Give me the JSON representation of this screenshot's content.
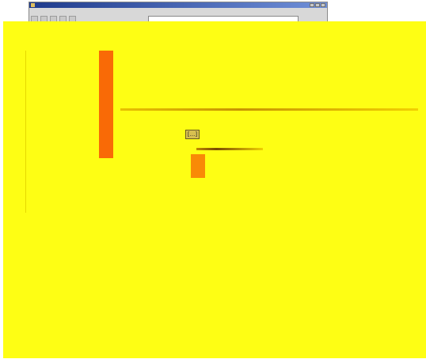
{
  "window": {
    "menu": [],
    "toolbar_icons": [
      "back-icon",
      "forward-icon",
      "stop-icon",
      "refresh-icon",
      "home-icon"
    ],
    "address_value": "",
    "selects": [
      {
        "name": "select-1",
        "value": ""
      },
      {
        "name": "select-2",
        "value": ""
      },
      {
        "name": "select-3",
        "value": ""
      }
    ]
  },
  "content": {
    "badge": "[...]",
    "accent_colors": {
      "background": "#fefe14",
      "primary_bar": "#f96a06",
      "secondary_bar": "#f98a06",
      "ribbon": "#2a2ab8"
    }
  }
}
